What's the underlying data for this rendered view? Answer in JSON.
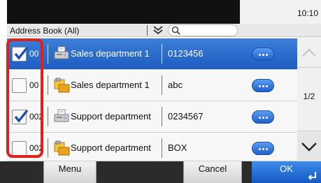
{
  "status": {
    "clock": "10:10"
  },
  "filter": {
    "label": "Address Book (All)",
    "search_placeholder": ""
  },
  "rows": [
    {
      "num": "00",
      "name": "Sales department 1",
      "destination": "0123456",
      "type": "fax",
      "checked": true,
      "selected": true
    },
    {
      "num": "00",
      "name": "Sales department 1",
      "destination": "abc",
      "type": "folder",
      "checked": false,
      "selected": false
    },
    {
      "num": "002",
      "name": "Support department",
      "destination": "0234567",
      "type": "fax",
      "checked": true,
      "selected": false
    },
    {
      "num": "002",
      "name": "Support department",
      "destination": "BOX",
      "type": "folder",
      "checked": false,
      "selected": false
    }
  ],
  "pager": {
    "indicator": "1/2"
  },
  "actions": {
    "menu": "Menu",
    "cancel": "Cancel",
    "ok": "OK"
  },
  "colors": {
    "selected_row": "#2a6fd0",
    "highlight_frame": "#e0201b",
    "ok_button": "#1f6fd8"
  }
}
